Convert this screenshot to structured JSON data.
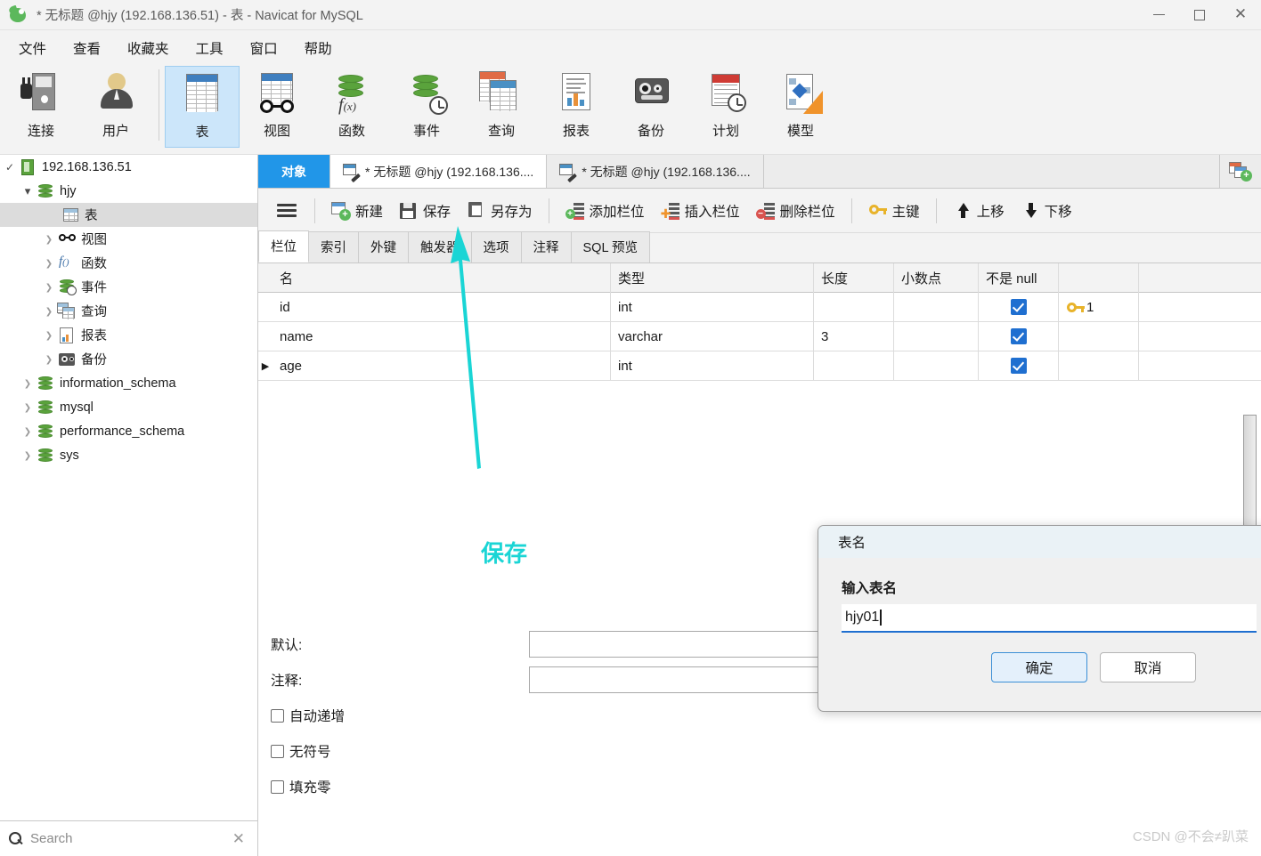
{
  "window": {
    "title": "* 无标题 @hjy (192.168.136.51) - 表 - Navicat for MySQL",
    "app_icon": "navicat-logo-icon",
    "minimize": "minimize-icon",
    "maximize": "maximize-icon",
    "close": "close-icon"
  },
  "menu": {
    "items": [
      {
        "label": "文件"
      },
      {
        "label": "查看"
      },
      {
        "label": "收藏夹"
      },
      {
        "label": "工具"
      },
      {
        "label": "窗口"
      },
      {
        "label": "帮助"
      }
    ]
  },
  "toolbar": {
    "items": [
      {
        "label": "连接",
        "icon": "connection-icon",
        "active": false
      },
      {
        "label": "用户",
        "icon": "user-icon",
        "active": false
      },
      {
        "label": "表",
        "icon": "table-icon",
        "active": true
      },
      {
        "label": "视图",
        "icon": "view-icon",
        "active": false
      },
      {
        "label": "函数",
        "icon": "function-icon",
        "active": false
      },
      {
        "label": "事件",
        "icon": "event-icon",
        "active": false
      },
      {
        "label": "查询",
        "icon": "query-icon",
        "active": false
      },
      {
        "label": "报表",
        "icon": "report-icon",
        "active": false
      },
      {
        "label": "备份",
        "icon": "backup-icon",
        "active": false
      },
      {
        "label": "计划",
        "icon": "schedule-icon",
        "active": false
      },
      {
        "label": "模型",
        "icon": "model-icon",
        "active": false
      }
    ]
  },
  "sidebar": {
    "tree": [
      {
        "label": "192.168.136.51",
        "icon": "server-icon",
        "indent": 0,
        "chev": "check",
        "selected": false
      },
      {
        "label": "hjy",
        "icon": "database-icon",
        "indent": 1,
        "chev": "down",
        "selected": false
      },
      {
        "label": "表",
        "icon": "table-icon",
        "indent": 3,
        "chev": "none",
        "selected": true
      },
      {
        "label": "视图",
        "icon": "view-icon",
        "indent": 2,
        "chev": "right",
        "selected": false
      },
      {
        "label": "函数",
        "icon": "function-icon",
        "indent": 2,
        "chev": "right",
        "selected": false
      },
      {
        "label": "事件",
        "icon": "event-icon",
        "indent": 2,
        "chev": "right",
        "selected": false
      },
      {
        "label": "查询",
        "icon": "query-icon",
        "indent": 2,
        "chev": "right",
        "selected": false
      },
      {
        "label": "报表",
        "icon": "report-icon",
        "indent": 2,
        "chev": "right",
        "selected": false
      },
      {
        "label": "备份",
        "icon": "backup-icon",
        "indent": 2,
        "chev": "right",
        "selected": false
      },
      {
        "label": "information_schema",
        "icon": "database-icon",
        "indent": 1,
        "chev": "right",
        "selected": false
      },
      {
        "label": "mysql",
        "icon": "database-icon",
        "indent": 1,
        "chev": "right",
        "selected": false
      },
      {
        "label": "performance_schema",
        "icon": "database-icon",
        "indent": 1,
        "chev": "right",
        "selected": false
      },
      {
        "label": "sys",
        "icon": "database-icon",
        "indent": 1,
        "chev": "right",
        "selected": false
      }
    ],
    "search": {
      "placeholder": "Search",
      "icon": "search-icon",
      "clear": "clear-icon"
    }
  },
  "tabs": {
    "items": [
      {
        "label": "对象",
        "style": "active-blue",
        "icon": "none"
      },
      {
        "label": "* 无标题 @hjy (192.168.136....",
        "style": "white",
        "icon": "table-designer-icon"
      },
      {
        "label": "* 无标题 @hjy (192.168.136....",
        "style": "grey",
        "icon": "table-designer-icon"
      }
    ],
    "add_tab": "add-tab-icon"
  },
  "actions": {
    "menu_icon": "hamburger-menu-icon",
    "buttons": [
      {
        "label": "新建",
        "icon": "new-icon"
      },
      {
        "label": "保存",
        "icon": "save-icon"
      },
      {
        "label": "另存为",
        "icon": "save-as-icon"
      },
      {
        "label": "添加栏位",
        "icon": "add-column-icon"
      },
      {
        "label": "插入栏位",
        "icon": "insert-column-icon"
      },
      {
        "label": "删除栏位",
        "icon": "delete-column-icon"
      },
      {
        "label": "主键",
        "icon": "primary-key-icon"
      },
      {
        "label": "上移",
        "icon": "move-up-icon"
      },
      {
        "label": "下移",
        "icon": "move-down-icon"
      }
    ]
  },
  "subtabs": {
    "items": [
      {
        "label": "栏位",
        "active": true
      },
      {
        "label": "索引",
        "active": false
      },
      {
        "label": "外键",
        "active": false
      },
      {
        "label": "触发器",
        "active": false
      },
      {
        "label": "选项",
        "active": false
      },
      {
        "label": "注释",
        "active": false
      },
      {
        "label": "SQL 预览",
        "active": false
      }
    ]
  },
  "grid": {
    "columns": [
      "名",
      "类型",
      "长度",
      "小数点",
      "不是 null",
      ""
    ],
    "rows": [
      {
        "marker": "",
        "name": "id",
        "type": "int",
        "length": "",
        "decimals": "",
        "not_null": true,
        "key": "1"
      },
      {
        "marker": "",
        "name": "name",
        "type": "varchar",
        "length": "3",
        "decimals": "",
        "not_null": true,
        "key": ""
      },
      {
        "marker": "▶",
        "name": "age",
        "type": "int",
        "length": "",
        "decimals": "",
        "not_null": true,
        "key": ""
      }
    ]
  },
  "properties": {
    "default_label": "默认:",
    "default_value": "",
    "comment_label": "注释:",
    "comment_value": "",
    "checkboxes": [
      {
        "label": "自动递增",
        "checked": false
      },
      {
        "label": "无符号",
        "checked": false
      },
      {
        "label": "填充零",
        "checked": false
      }
    ]
  },
  "annotation": {
    "label": "保存",
    "color": "#1ad5d5",
    "arrow": "save-pointer-arrow"
  },
  "dialog": {
    "title": "表名",
    "field_label": "输入表名",
    "field_value": "hjy01",
    "ok_label": "确定",
    "cancel_label": "取消"
  },
  "watermark": {
    "text": "CSDN @不会≠趴菜"
  },
  "colors": {
    "accent_blue": "#2196e8",
    "checkbox_blue": "#1f6fd0",
    "annotation_cyan": "#1ad5d5",
    "db_green": "#5aa33c",
    "key_gold": "#e8b32a"
  }
}
